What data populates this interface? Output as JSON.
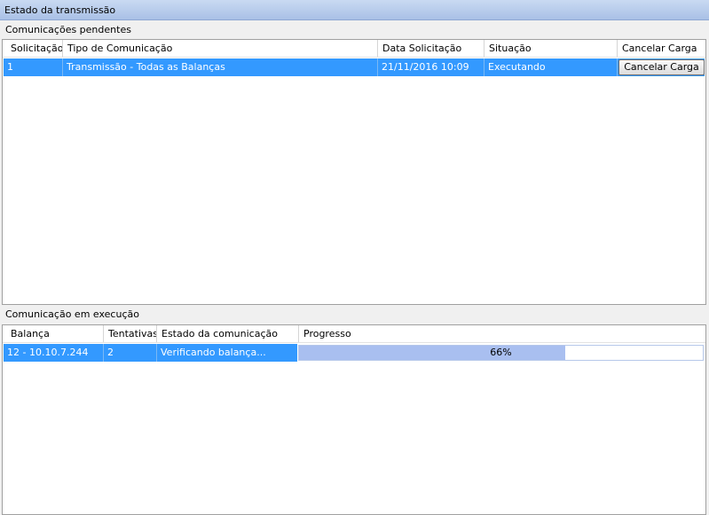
{
  "window": {
    "title": "Estado da transmissão"
  },
  "pending": {
    "label": "Comunicações pendentes",
    "columns": [
      "Solicitação",
      "Tipo de Comunicação",
      "Data Solicitação",
      "Situação",
      "Cancelar Carga"
    ],
    "rows": [
      {
        "id": "1",
        "type": "Transmissão - Todas as Balanças",
        "date": "21/11/2016 10:09",
        "status": "Executando",
        "cancel_label": "Cancelar Carga"
      }
    ]
  },
  "running": {
    "label": "Comunicação em execução",
    "columns": [
      "Balança",
      "Tentativas",
      "Estado da comunicação",
      "Progresso"
    ],
    "rows": [
      {
        "scale": "12 - 10.10.7.244",
        "attempts": "2",
        "state": "Verificando balança...",
        "progress_text": "66%",
        "progress_fraction": 0.66
      }
    ]
  },
  "colors": {
    "selection": "#3399ff",
    "progress_fill": "#a9bff0",
    "titlebar": "#b9cdee"
  }
}
